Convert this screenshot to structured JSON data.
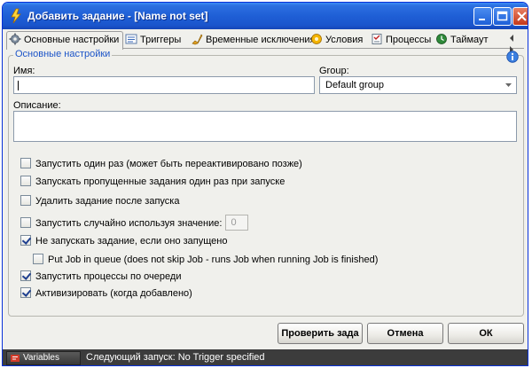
{
  "window": {
    "title": "Добавить задание - [Name not set]"
  },
  "tabs": [
    {
      "label": "Основные настройки",
      "icon": "gear-icon",
      "active": true
    },
    {
      "label": "Триггеры",
      "icon": "list-icon"
    },
    {
      "label": "Временные исключения",
      "icon": "brush-icon"
    },
    {
      "label": "Условия",
      "icon": "condition-icon"
    },
    {
      "label": "Процессы",
      "icon": "process-icon"
    },
    {
      "label": "Таймаут",
      "icon": "timeout-icon"
    }
  ],
  "group": {
    "title": "Основные настройки"
  },
  "form": {
    "name_label": "Имя:",
    "name_value": "",
    "group_label": "Group:",
    "group_value": "Default group",
    "description_label": "Описание:",
    "description_value": ""
  },
  "options": [
    {
      "label": "Запустить один раз (может быть переактивировано позже)",
      "checked": false
    },
    {
      "label": "Запускать пропущенные задания один раз при запуске",
      "checked": false
    },
    {
      "label": "Удалить задание после запуска",
      "checked": false
    },
    {
      "label": "Запустить случайно используя значение:",
      "checked": false,
      "value": "0"
    },
    {
      "label": "Не запускать задание, если оно запущено",
      "checked": true
    },
    {
      "label": "Put Job in queue (does not skip Job - runs Job when running Job is finished)",
      "checked": false
    },
    {
      "label": "Запустить процессы по очереди",
      "checked": true
    },
    {
      "label": "Активизировать (когда добавлено)",
      "checked": true
    }
  ],
  "buttons": {
    "check": "Проверить зада",
    "cancel": "Отмена",
    "ok": "ОК"
  },
  "statusbar": {
    "variables": "Variables",
    "next_run": "Следующий запуск: No Trigger specified"
  },
  "colors": {
    "titlebar": "#1f5fd6",
    "group_title": "#1d55c8",
    "statusbar": "#3c3c3c"
  }
}
